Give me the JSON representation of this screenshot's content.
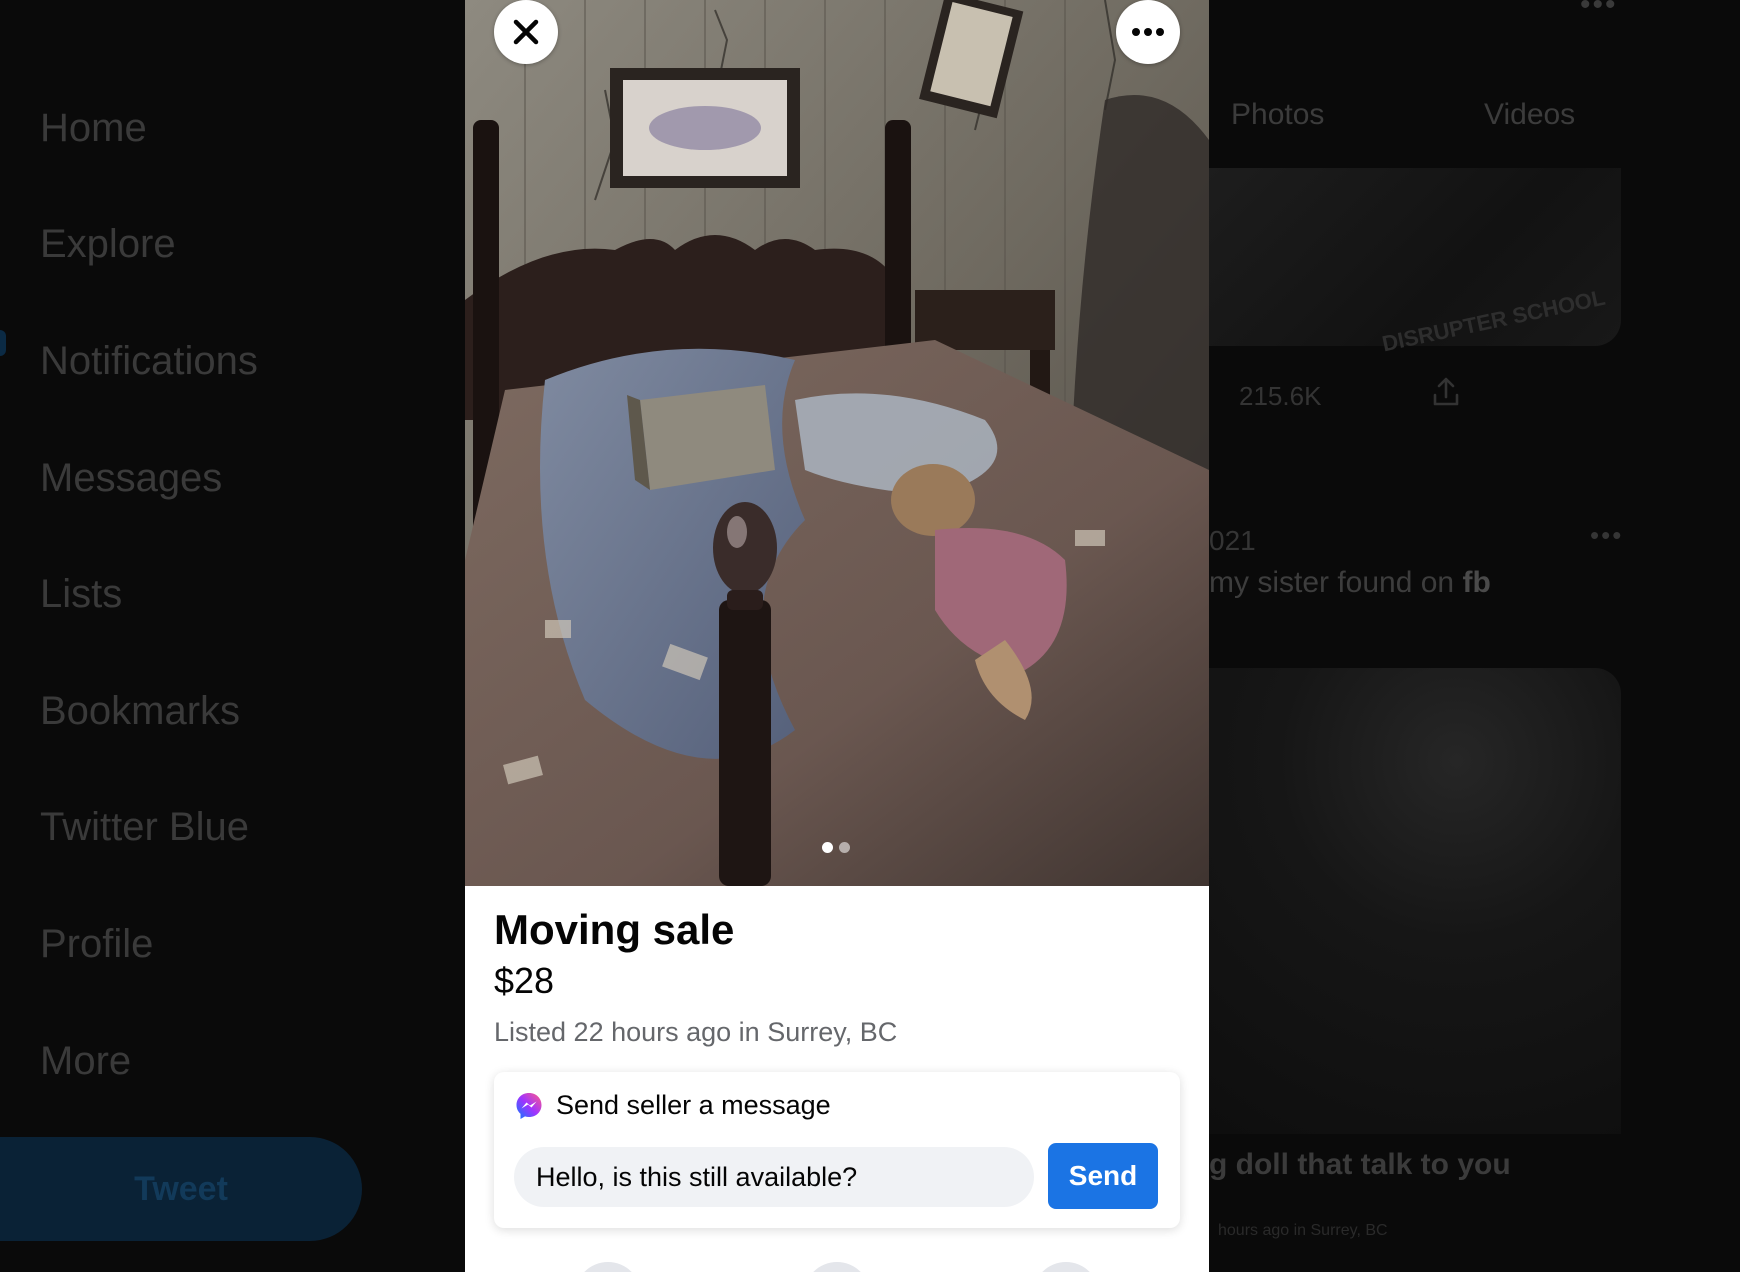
{
  "background": {
    "nav": {
      "items": [
        {
          "label": "Home"
        },
        {
          "label": "Explore"
        },
        {
          "label": "Notifications"
        },
        {
          "label": "Messages"
        },
        {
          "label": "Lists"
        },
        {
          "label": "Bookmarks"
        },
        {
          "label": "Twitter Blue"
        },
        {
          "label": "Profile"
        },
        {
          "label": "More"
        }
      ],
      "tweet_button": "Tweet"
    },
    "top_more": "•••",
    "tabs": [
      {
        "label": "Photos"
      },
      {
        "label": "Videos"
      }
    ],
    "media_top_watermark": "DISRUPTER SCHOOL",
    "stats": {
      "views": "215.6K",
      "share_icon": "share-icon"
    },
    "post": {
      "date": "021",
      "more": "•••",
      "text_prefix": "my sister found on ",
      "text_bold": "fb"
    },
    "card": {
      "title": "g doll that talk to you",
      "subtitle": "hours ago in Surrey, BC"
    }
  },
  "listing": {
    "title": "Moving sale",
    "price": "$28",
    "meta": "Listed 22 hours ago in Surrey, BC",
    "photo_pager": {
      "count": 2,
      "active": 0
    },
    "close_icon": "close-icon",
    "more_icon": "more-horizontal-icon",
    "message": {
      "heading": "Send seller a message",
      "icon": "messenger-icon",
      "input_value": "Hello, is this still available?",
      "send_label": "Send"
    }
  },
  "colors": {
    "accent": "#1b74e4",
    "text_primary": "#050505",
    "text_secondary": "#65676b",
    "input_bg": "#f0f2f5",
    "page_bg": "#0a0a0a"
  }
}
